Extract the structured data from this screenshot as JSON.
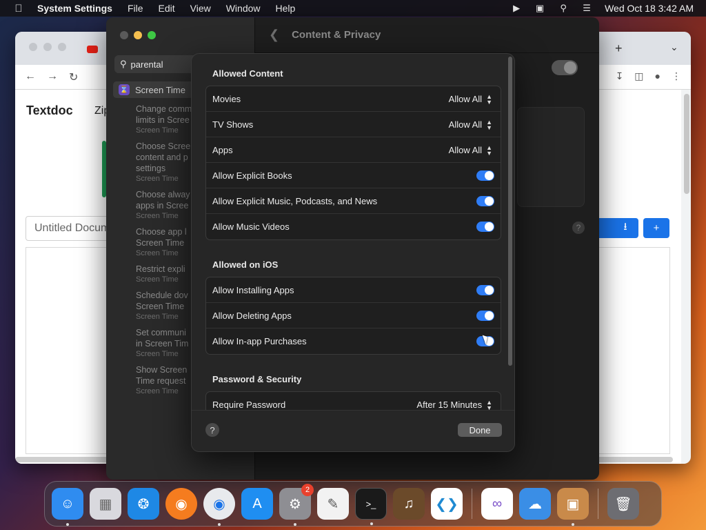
{
  "menubar": {
    "app_name": "System Settings",
    "menus": [
      "File",
      "Edit",
      "View",
      "Window",
      "Help"
    ],
    "datetime": "Wed Oct 18  3:42 AM"
  },
  "chrome": {
    "brand": "Textdoc",
    "brand2": "Zip",
    "doc_name": "Untitled Document"
  },
  "settings": {
    "search_value": "parental",
    "sidebar_selected": "Screen Time",
    "results": [
      {
        "title": "Change comm\nlimits in Scree",
        "sub": "Screen Time"
      },
      {
        "title": "Choose Scree\ncontent and p\nsettings",
        "sub": "Screen Time"
      },
      {
        "title": "Choose alway\napps in Scree",
        "sub": "Screen Time"
      },
      {
        "title": "Choose app l\nScreen Time",
        "sub": "Screen Time"
      },
      {
        "title": "Restrict expli",
        "sub": "Screen Time"
      },
      {
        "title": "Schedule dov\nScreen Time",
        "sub": "Screen Time"
      },
      {
        "title": "Set communi\nin Screen Tim",
        "sub": "Screen Time"
      },
      {
        "title": "Show Screen\nTime request",
        "sub": "Screen Time"
      }
    ],
    "header_title": "Content & Privacy"
  },
  "sheet": {
    "sections": [
      {
        "title": "Allowed Content",
        "rows": [
          {
            "label": "Movies",
            "value": "Allow All"
          },
          {
            "label": "TV Shows",
            "value": "Allow All"
          },
          {
            "label": "Apps",
            "value": "Allow All"
          },
          {
            "label": "Allow Explicit Books",
            "toggle": true
          },
          {
            "label": "Allow Explicit Music, Podcasts, and News",
            "toggle": true
          },
          {
            "label": "Allow Music Videos",
            "toggle": true
          }
        ]
      },
      {
        "title": "Allowed on iOS",
        "rows": [
          {
            "label": "Allow Installing Apps",
            "toggle": true
          },
          {
            "label": "Allow Deleting Apps",
            "toggle": true
          },
          {
            "label": "Allow In-app Purchases",
            "toggle": true
          }
        ]
      },
      {
        "title": "Password & Security",
        "rows": [
          {
            "label": "Require Password",
            "value": "After 15 Minutes"
          }
        ]
      }
    ],
    "help_label": "?",
    "done_label": "Done"
  },
  "dock": {
    "apps": [
      {
        "name": "Finder",
        "icon": "finder-icon",
        "color": "#2f8cf0"
      },
      {
        "name": "Launchpad",
        "icon": "launchpad-icon",
        "color": "#d9d9de"
      },
      {
        "name": "Safari",
        "icon": "safari-icon",
        "color": "#1e88e5"
      },
      {
        "name": "Firefox",
        "icon": "firefox-icon",
        "color": "#f57c1f"
      },
      {
        "name": "Chrome",
        "icon": "chrome-icon",
        "color": "#e8eaed"
      },
      {
        "name": "App Store",
        "icon": "app-store-icon",
        "color": "#1f8ef1"
      },
      {
        "name": "System Settings",
        "icon": "system-settings-icon",
        "color": "#8e8e93",
        "badge": "2"
      },
      {
        "name": "TextEdit",
        "icon": "textedit-icon",
        "color": "#f2f2f2"
      },
      {
        "name": "Terminal",
        "icon": "terminal-icon",
        "color": "#1a1a1a"
      },
      {
        "name": "Instruments",
        "icon": "instruments-icon",
        "color": "#6b4a2a"
      },
      {
        "name": "Visual Studio Code",
        "icon": "vscode-icon",
        "color": "#ffffff"
      },
      {
        "name": "Visual Studio",
        "icon": "visual-studio-icon",
        "color": "#ffffff"
      },
      {
        "name": "Weather",
        "icon": "weather-icon",
        "color": "#3a8ee6"
      },
      {
        "name": "Archive Utility",
        "icon": "archive-utility-icon",
        "color": "#c98a4a"
      },
      {
        "name": "Trash",
        "icon": "trash-icon",
        "color": "#6d6d72"
      }
    ]
  }
}
